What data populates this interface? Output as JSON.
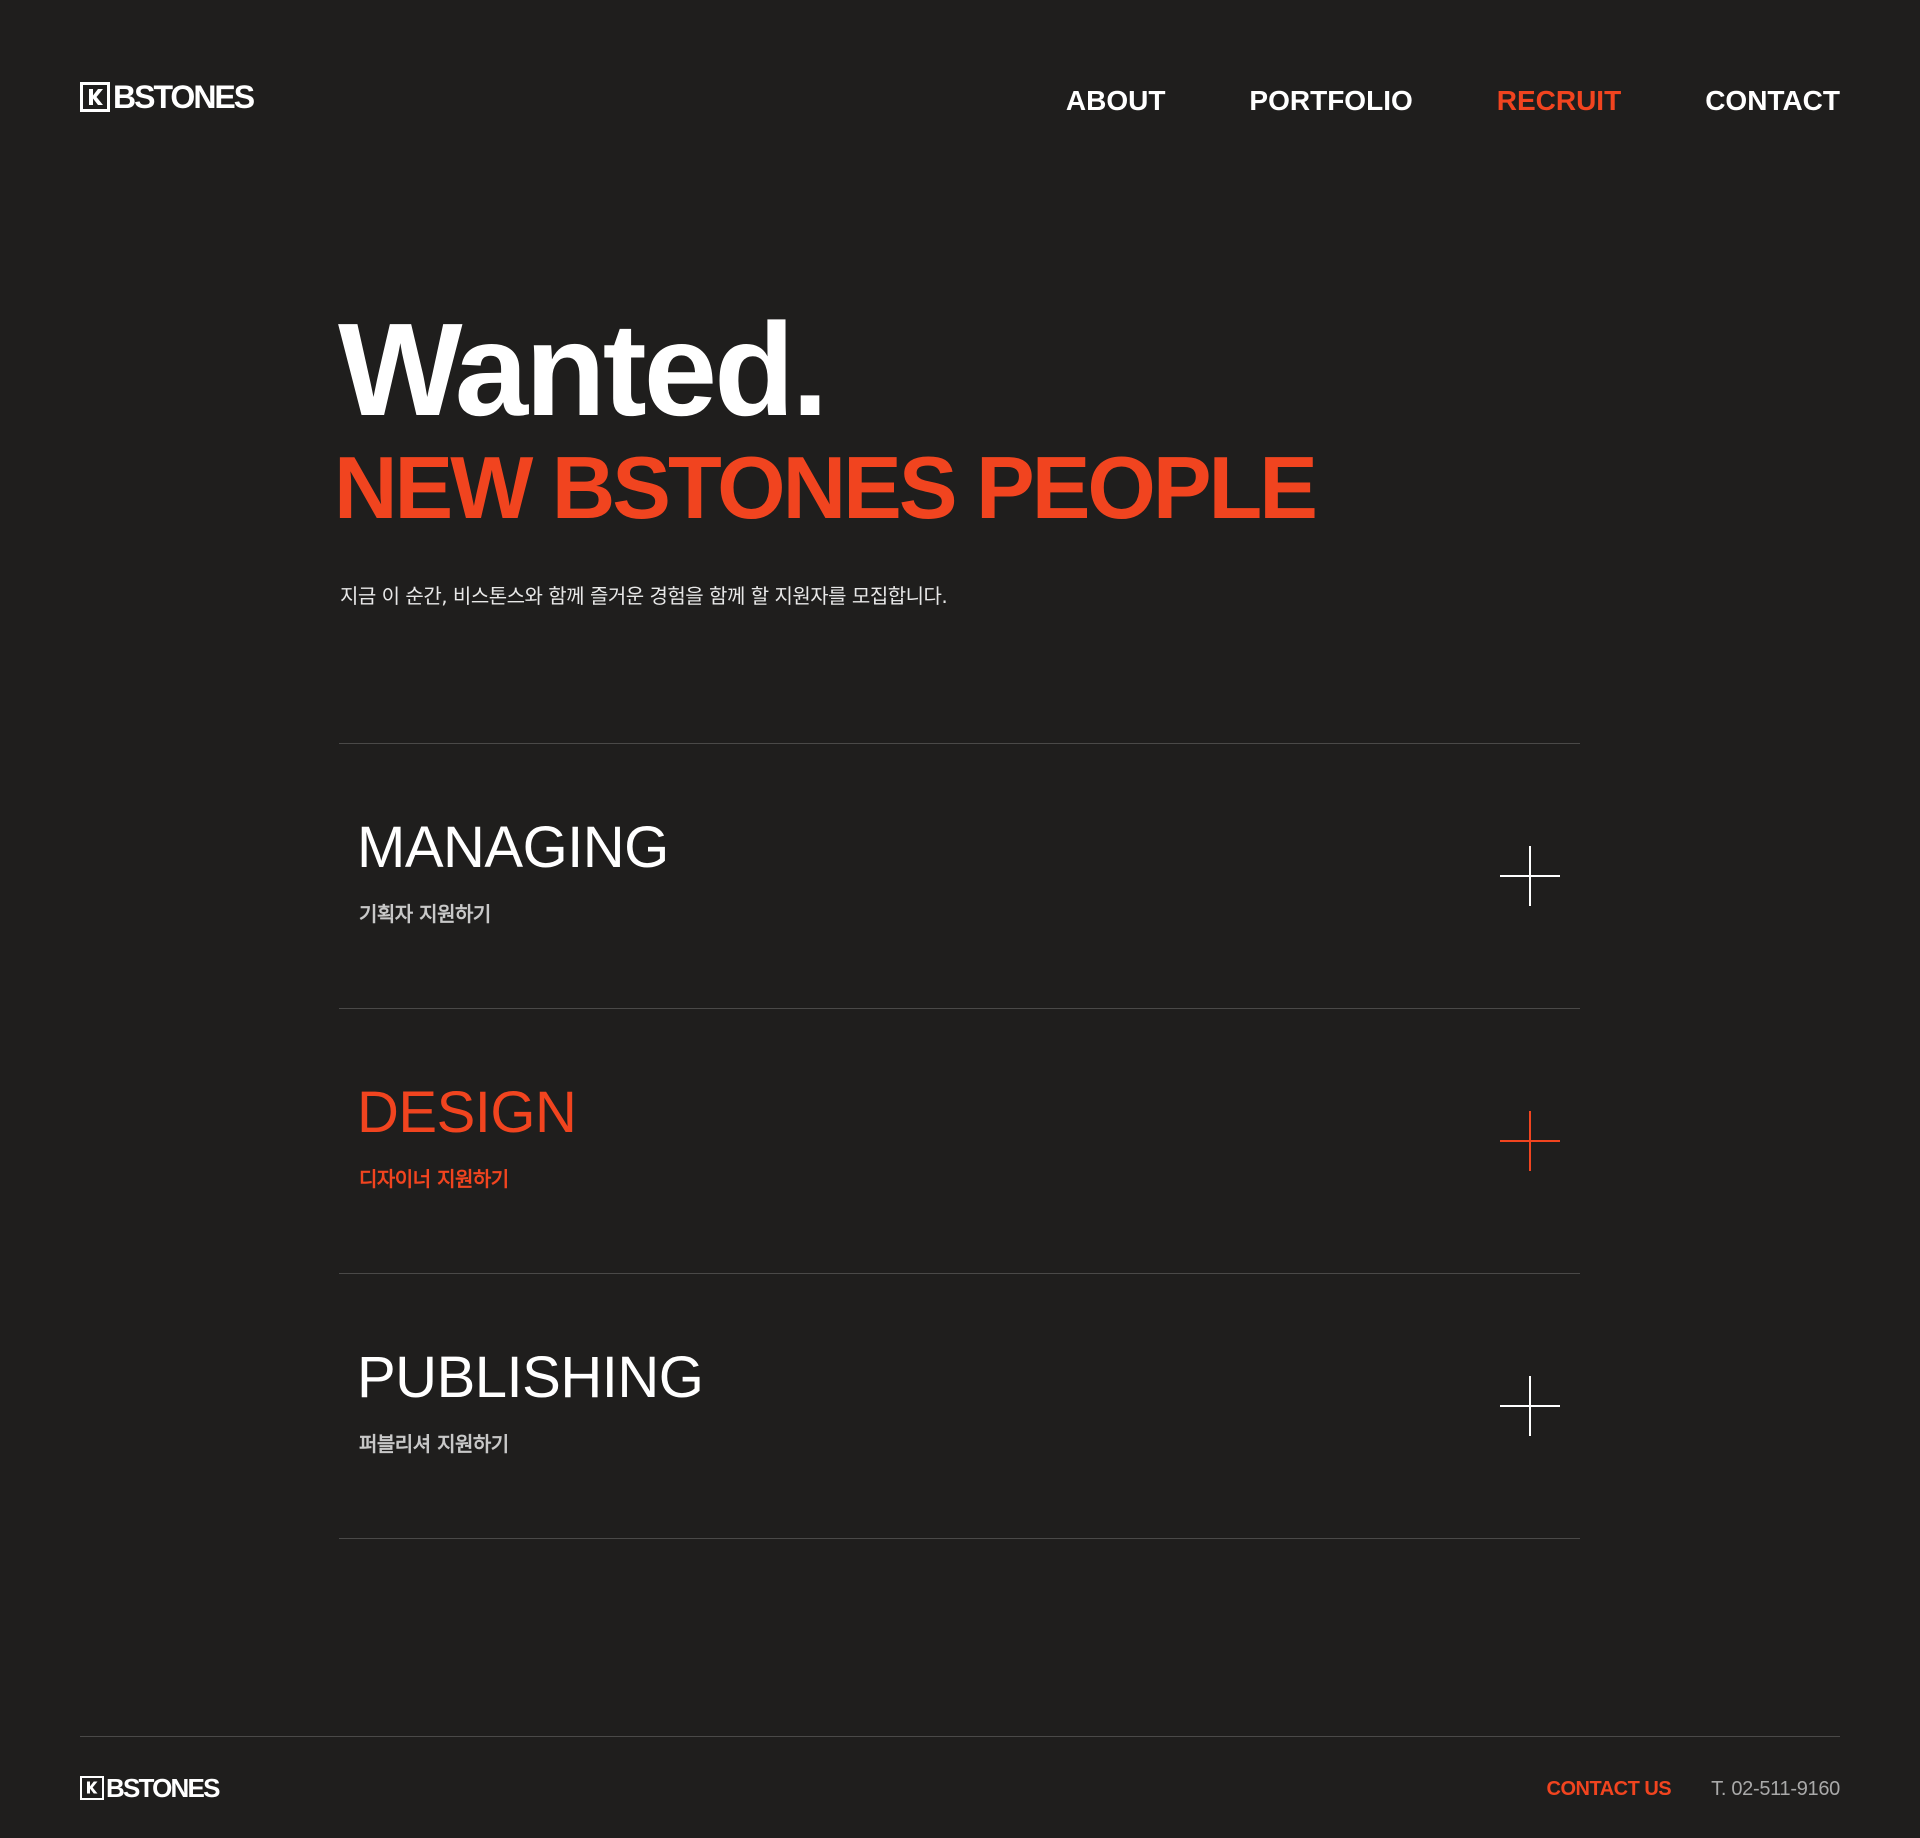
{
  "header": {
    "logo_text": "BSTONES",
    "logo_mark_letter": "K",
    "nav": [
      {
        "label": "ABOUT",
        "active": false
      },
      {
        "label": "PORTFOLIO",
        "active": false
      },
      {
        "label": "RECRUIT",
        "active": true
      },
      {
        "label": "CONTACT",
        "active": false
      }
    ]
  },
  "hero": {
    "title": "Wanted.",
    "subtitle": "NEW BSTONES PEOPLE",
    "description": "지금 이 순간, 비스톤스와 함께 즐거운 경험을 함께 할 지원자를 모집합니다."
  },
  "jobs": [
    {
      "title": "MANAGING",
      "desc": "기획자 지원하기",
      "highlighted": false,
      "icon": "plus-icon"
    },
    {
      "title": "DESIGN",
      "desc": "디자이너 지원하기",
      "highlighted": true,
      "icon": "plus-icon"
    },
    {
      "title": "PUBLISHING",
      "desc": "퍼블리셔 지원하기",
      "highlighted": false,
      "icon": "plus-icon"
    }
  ],
  "footer": {
    "logo_text": "BSTONES",
    "contact_label": "CONTACT US",
    "phone": "T. 02-511-9160"
  },
  "colors": {
    "background": "#1f1e1d",
    "accent": "#f1441f",
    "text": "#ffffff",
    "divider": "#4a4948",
    "muted": "#a9a9a9"
  }
}
